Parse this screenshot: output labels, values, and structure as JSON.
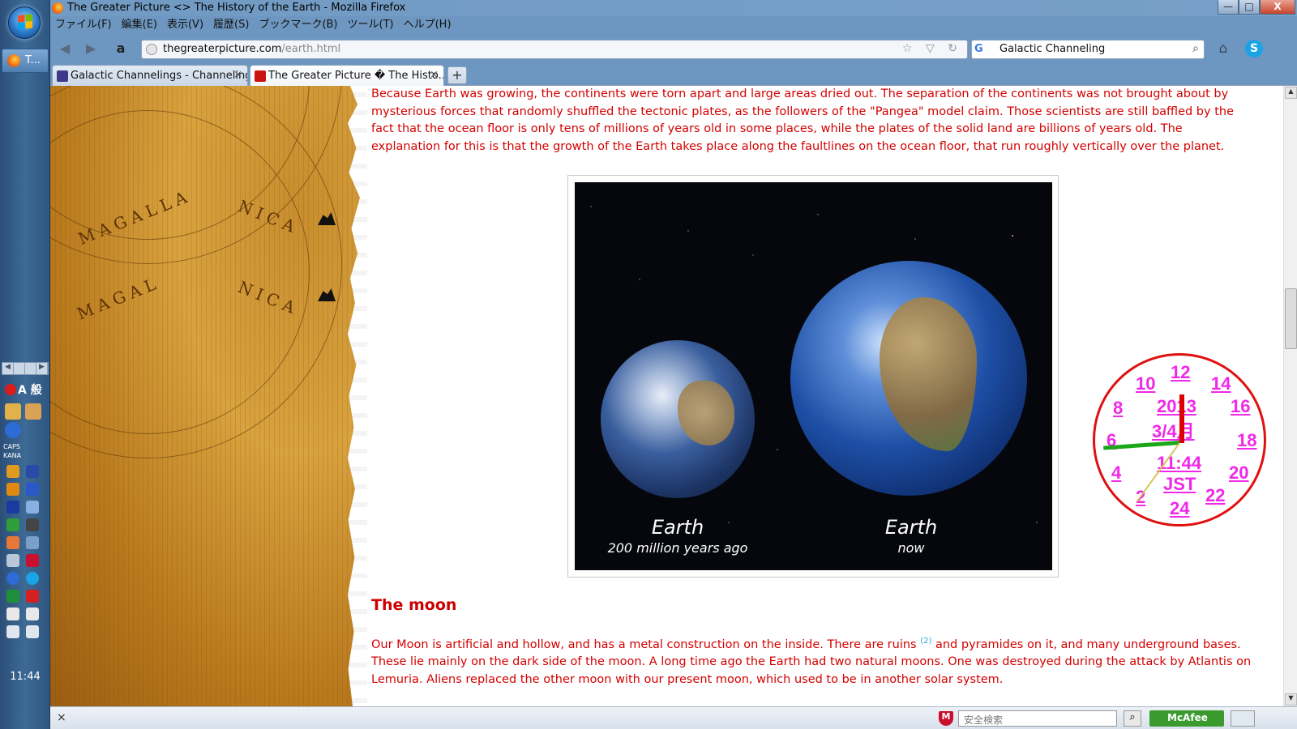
{
  "window": {
    "title": "The Greater Picture <> The History of the Earth - Mozilla Firefox",
    "controls": {
      "minimize": "—",
      "maximize": "□",
      "close": "X"
    }
  },
  "menu": [
    "ファイル(F)",
    "編集(E)",
    "表示(V)",
    "履歴(S)",
    "ブックマーク(B)",
    "ツール(T)",
    "ヘルプ(H)"
  ],
  "nav": {
    "back_icon": "arrow-left",
    "forward_icon": "arrow-right",
    "amazon_label": "a",
    "url_host": "thegreaterpicture.com",
    "url_path": "/earth.html",
    "url_actions": "☆ ▽ ↻",
    "search_value": "Galactic Channeling",
    "search_engine": "G"
  },
  "tabs": [
    {
      "label": "Galactic Channelings - Channeling...",
      "active": false,
      "icon_color": "#3d3a8c"
    },
    {
      "label": "The Greater Picture � The Histo...",
      "active": true,
      "icon_color": "#cc1111"
    }
  ],
  "taskbar": {
    "firefox_label": "T...",
    "ime_mode": "A 般",
    "caps": "CAPS",
    "kana": "KANA",
    "pager": [
      "◀",
      "",
      "",
      "▶"
    ],
    "clock": "11:44"
  },
  "article": {
    "intro": "Because Earth was growing, the continents were torn apart and large areas dried out. The separation of the continents was not brought about by mysterious forces that randomly shuffled the tectonic plates, as the followers of the \"Pangea\" model claim. Those scientists are still baffled by the fact that the ocean floor is only tens of millions of years old in some places, while the plates of the solid land are billions of years old. The explanation for this is that the growth of the Earth takes place along the faultlines on the ocean floor, that run roughly vertically over the planet.",
    "figure": {
      "left_title": "Earth",
      "left_sub": "200 million years ago",
      "right_title": "Earth",
      "right_sub": "now"
    },
    "moon_heading": "The moon",
    "moon_p1": "Our Moon is artificial and hollow, and has a metal construction on the inside. There are ruins",
    "moon_ref": "(2)",
    "moon_p2": " and pyramides on it, and many underground bases. These lie mainly on the dark side of the moon. A long time ago the Earth had two natural moons. One was destroyed during the attack by Atlantis on Lemuria. Aliens replaced the other moon with our present moon, which used to be in another solar system."
  },
  "map_labels": [
    "MAGALLA",
    "NICA",
    "MAGAL",
    "NICA"
  ],
  "clock_widget": {
    "hours": [
      "12",
      "14",
      "16",
      "18",
      "20",
      "22",
      "24",
      "2",
      "4",
      "6",
      "8",
      "10"
    ],
    "date_year": "2013",
    "date_md": "3/4月",
    "time": "11:44",
    "tz": "JST"
  },
  "statusbar": {
    "close": "×",
    "search_placeholder": "安全検索",
    "mcafee": "McAfee",
    "shield": "M"
  }
}
